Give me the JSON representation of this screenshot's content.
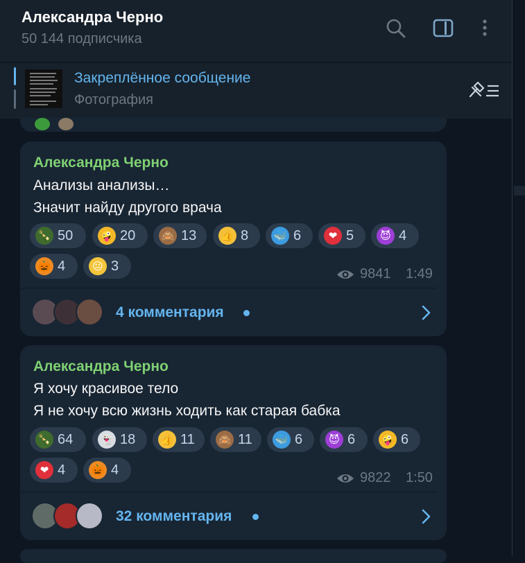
{
  "header": {
    "title": "Александра Черно",
    "subtitle": "50 144 подписчика"
  },
  "pinned": {
    "title": "Закреплённое сообщение",
    "subtitle": "Фотография"
  },
  "posts": [
    {
      "author": "Александра Черно",
      "lines": [
        "Анализы анализы…",
        "Значит найду другого врача"
      ],
      "reactions": [
        {
          "icon": "champagne-icon",
          "glyph": "🍾",
          "count": "50"
        },
        {
          "icon": "zany-face-icon",
          "glyph": "🤪",
          "count": "20"
        },
        {
          "icon": "see-no-evil-monkey-icon",
          "glyph": "🙈",
          "count": "13"
        },
        {
          "icon": "thumbs-up-icon",
          "glyph": "👍",
          "count": "8"
        },
        {
          "icon": "whale-icon",
          "glyph": "🐳",
          "count": "6"
        },
        {
          "icon": "heart-icon",
          "glyph": "❤",
          "count": "5"
        },
        {
          "icon": "smiling-devil-icon",
          "glyph": "😈",
          "count": "4"
        },
        {
          "icon": "pumpkin-icon",
          "glyph": "🎃",
          "count": "4"
        },
        {
          "icon": "neutral-face-icon",
          "glyph": "😐",
          "count": "3"
        }
      ],
      "views": "9841",
      "time": "1:49",
      "comments": "4 комментария"
    },
    {
      "author": "Александра Черно",
      "lines": [
        "Я хочу красивое тело",
        "Я не хочу всю жизнь ходить как старая бабка"
      ],
      "reactions": [
        {
          "icon": "champagne-icon",
          "glyph": "🍾",
          "count": "64"
        },
        {
          "icon": "ghost-icon",
          "glyph": "👻",
          "count": "18"
        },
        {
          "icon": "thumbs-up-icon",
          "glyph": "👍",
          "count": "11"
        },
        {
          "icon": "see-no-evil-monkey-icon",
          "glyph": "🙈",
          "count": "11"
        },
        {
          "icon": "whale-icon",
          "glyph": "🐳",
          "count": "6"
        },
        {
          "icon": "smiling-devil-icon",
          "glyph": "😈",
          "count": "6"
        },
        {
          "icon": "zany-face-icon",
          "glyph": "🤪",
          "count": "6"
        },
        {
          "icon": "heart-icon",
          "glyph": "❤",
          "count": "4"
        },
        {
          "icon": "pumpkin-icon",
          "glyph": "🎃",
          "count": "4"
        }
      ],
      "views": "9822",
      "time": "1:50",
      "comments": "32 комментария"
    }
  ],
  "colors": {
    "background": "#0e1621",
    "panel": "#17212b",
    "bubble": "#182533",
    "author": "#7fd173",
    "accent": "#64b5ef",
    "muted": "#6c7883",
    "reaction": "#2b3b4c"
  }
}
